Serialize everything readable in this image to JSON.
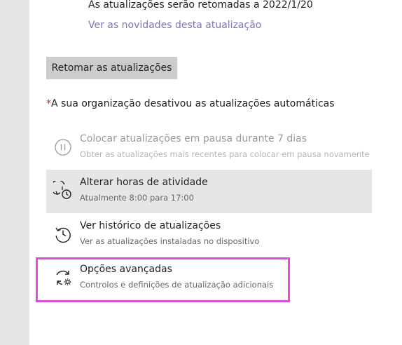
{
  "updates": {
    "resume_text": "As atualizações serão retomadas a 2022/1/20",
    "news_link": "Ver as novidades desta atualização",
    "resume_button": "Retomar as atualizações",
    "org_note_asterisk": "*",
    "org_note": "A sua organização desativou as atualizações automáticas"
  },
  "options": [
    {
      "icon": "pause-icon",
      "title": "Colocar atualizações em pausa durante 7 dias",
      "subtitle": "Obter as atualizações mais recentes para colocar em pausa novamente"
    },
    {
      "icon": "active-hours-icon",
      "title": "Alterar horas de atividade",
      "subtitle": "Atualmente 8:00 para 17:00"
    },
    {
      "icon": "history-icon",
      "title": "Ver histórico de atualizações",
      "subtitle": "Ver as atualizações instaladas no dispositivo"
    },
    {
      "icon": "advanced-options-icon",
      "title": "Opções avançadas",
      "subtitle": "Controlos e definições de atualização adicionais"
    }
  ],
  "colors": {
    "link": "#7a74b8",
    "focus_outline": "#e14be0",
    "highlight": "#e6e6e6",
    "asterisk": "#c42b1c"
  }
}
